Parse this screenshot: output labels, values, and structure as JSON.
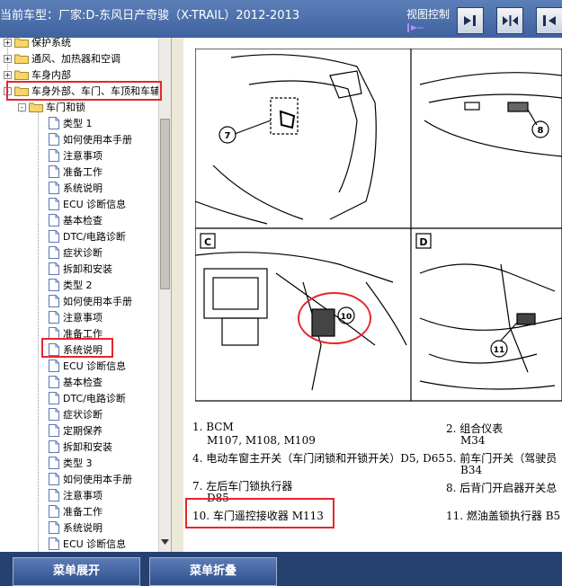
{
  "header": {
    "title": "当前车型：厂家:D-东风日产奇骏（X-TRAIL）2012-2013",
    "view_control_label": "视图控制"
  },
  "tree": {
    "items": [
      {
        "label": "保护系统",
        "type": "folder",
        "expander": "+"
      },
      {
        "label": "通风、加热器和空调",
        "type": "folder",
        "expander": "+"
      },
      {
        "label": "车身内部",
        "type": "folder",
        "expander": "+"
      },
      {
        "label": "车身外部、车门、车顶和车辅",
        "type": "folder",
        "expander": "-"
      },
      {
        "label": "车门和锁",
        "type": "folder",
        "expander": "-"
      },
      {
        "label": "类型 1",
        "type": "page"
      },
      {
        "label": "如何使用本手册",
        "type": "page"
      },
      {
        "label": "注意事项",
        "type": "page"
      },
      {
        "label": "准备工作",
        "type": "page"
      },
      {
        "label": "系统说明",
        "type": "page"
      },
      {
        "label": "ECU 诊断信息",
        "type": "page"
      },
      {
        "label": "基本检查",
        "type": "page"
      },
      {
        "label": "DTC/电路诊断",
        "type": "page"
      },
      {
        "label": "症状诊断",
        "type": "page"
      },
      {
        "label": "拆卸和安装",
        "type": "page"
      },
      {
        "label": "类型 2",
        "type": "page"
      },
      {
        "label": "如何使用本手册",
        "type": "page"
      },
      {
        "label": "注意事项",
        "type": "page"
      },
      {
        "label": "准备工作",
        "type": "page"
      },
      {
        "label": "系统说明",
        "type": "page"
      },
      {
        "label": "ECU 诊断信息",
        "type": "page"
      },
      {
        "label": "基本检查",
        "type": "page"
      },
      {
        "label": "DTC/电路诊断",
        "type": "page"
      },
      {
        "label": "症状诊断",
        "type": "page"
      },
      {
        "label": "定期保养",
        "type": "page"
      },
      {
        "label": "拆卸和安装",
        "type": "page"
      },
      {
        "label": "类型 3",
        "type": "page"
      },
      {
        "label": "如何使用本手册",
        "type": "page"
      },
      {
        "label": "注意事项",
        "type": "page"
      },
      {
        "label": "准备工作",
        "type": "page"
      },
      {
        "label": "系统说明",
        "type": "page"
      },
      {
        "label": "ECU 诊断信息",
        "type": "page"
      }
    ]
  },
  "diagram": {
    "panel_c": "C",
    "panel_d": "D",
    "callouts": [
      "7",
      "8",
      "10",
      "11"
    ]
  },
  "parts": {
    "p1": "1.  BCM",
    "p1_conn": "M107, M108, M109",
    "p2": "2.  组合仪表",
    "p2_conn": "M34",
    "p4": "4.  电动车窗主开关（车门闭锁和开锁开关）D5, D65",
    "p5": "5.  前车门开关（驾驶员",
    "p5_conn": "B34",
    "p7": "7.  左后车门锁执行器",
    "p7_conn": "D85",
    "p8": "8.  后背门开启器开关总",
    "p10": "10. 车门遥控接收器  M113",
    "p11": "11. 燃油盖锁执行器  B5"
  },
  "buttons": {
    "expand": "菜单展开",
    "collapse": "菜单折叠"
  }
}
